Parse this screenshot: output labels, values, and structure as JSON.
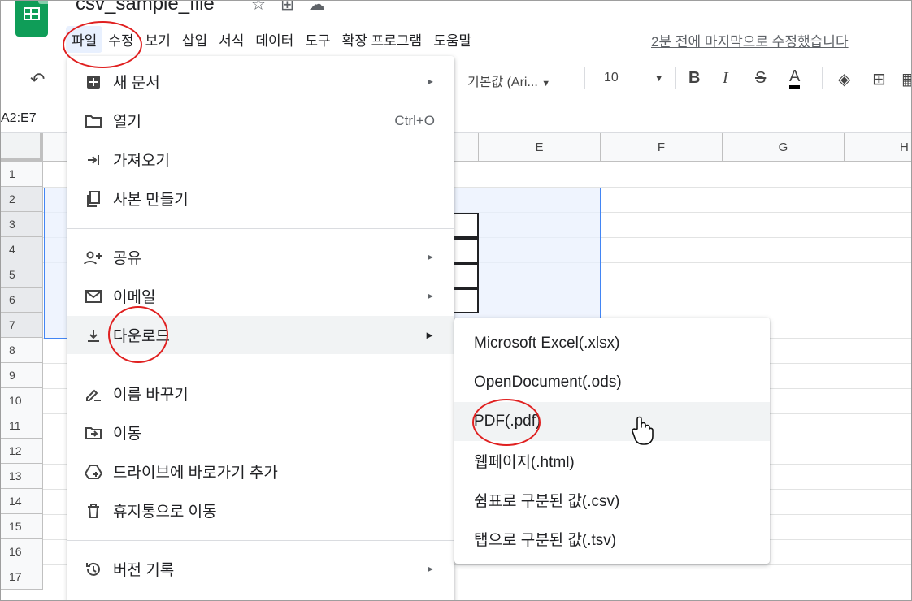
{
  "app": {
    "title": "csv_sample_file",
    "last_edit": "2분 전에 마지막으로 수정했습니다"
  },
  "title_icons": [
    "star-icon",
    "move-to-folder-icon",
    "cloud-status-icon"
  ],
  "menubar": [
    "파일",
    "수정",
    "보기",
    "삽입",
    "서식",
    "데이터",
    "도구",
    "확장 프로그램",
    "도움말"
  ],
  "toolbar": {
    "font": "기본값 (Ari...",
    "font_size": "10"
  },
  "name_box": "A2:E7",
  "columns": [
    "E",
    "F",
    "G",
    "H"
  ],
  "rows": [
    "1",
    "2",
    "3",
    "4",
    "5",
    "6",
    "7",
    "8",
    "9",
    "10",
    "11",
    "12",
    "13",
    "14",
    "15",
    "16",
    "17"
  ],
  "file_menu": {
    "items": [
      {
        "icon": "new-document-icon",
        "label": "새 문서",
        "arrow": "►"
      },
      {
        "icon": "folder-icon",
        "label": "열기",
        "shortcut": "Ctrl+O"
      },
      {
        "icon": "import-icon",
        "label": "가져오기"
      },
      {
        "icon": "copy-icon",
        "label": "사본 만들기"
      },
      {
        "icon": "share-person-icon",
        "label": "공유",
        "arrow": "►"
      },
      {
        "icon": "email-icon",
        "label": "이메일",
        "arrow": "►"
      },
      {
        "icon": "download-icon",
        "label": "다운로드",
        "arrow": "►"
      },
      {
        "icon": "rename-icon",
        "label": "이름 바꾸기"
      },
      {
        "icon": "move-icon",
        "label": "이동"
      },
      {
        "icon": "drive-shortcut-icon",
        "label": "드라이브에 바로가기 추가"
      },
      {
        "icon": "trash-icon",
        "label": "휴지통으로 이동"
      },
      {
        "icon": "history-icon",
        "label": "버전 기록",
        "arrow": "►"
      }
    ]
  },
  "download_menu": {
    "items": [
      "Microsoft Excel(.xlsx)",
      "OpenDocument(.ods)",
      "PDF(.pdf)",
      "웹페이지(.html)",
      "쉼표로 구분된 값(.csv)",
      "탭으로 구분된 값(.tsv)"
    ]
  },
  "colors": {
    "selection_border": "#4285f4",
    "annotation": "#e02020",
    "sheets_green": "#0f9d58"
  }
}
